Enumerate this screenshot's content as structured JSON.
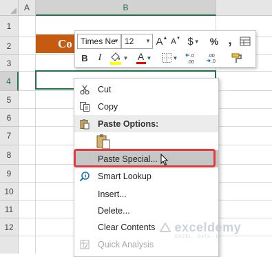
{
  "columns": {
    "corner_arrow": "select-all",
    "a": "A",
    "b": "B"
  },
  "rows": [
    "1",
    "2",
    "3",
    "4",
    "5",
    "6",
    "7",
    "8",
    "9",
    "10",
    "11",
    "12"
  ],
  "title_cell": {
    "text": "Co"
  },
  "mini_toolbar": {
    "font_name": "Times Ne",
    "font_size": "12",
    "increase_font": "A",
    "decrease_font": "A",
    "currency": "$",
    "percent": "%",
    "comma": "‚",
    "bold": "B",
    "italic": "I",
    "font_color_letter": "A",
    "fill_color": "#ffff00",
    "font_color": "#ff0000",
    "decimal_increase": ".00",
    "decimal_decrease": ".00"
  },
  "context_menu": {
    "items": [
      {
        "label": "Cut",
        "icon": "scissors-icon"
      },
      {
        "label": "Copy",
        "icon": "copy-icon"
      },
      {
        "label": "Paste Options:",
        "icon": "paste-icon"
      },
      {
        "label": "Paste Special...",
        "icon": ""
      },
      {
        "label": "Smart Lookup",
        "icon": "smart-lookup-icon"
      },
      {
        "label": "Insert...",
        "icon": ""
      },
      {
        "label": "Delete...",
        "icon": ""
      },
      {
        "label": "Clear Contents",
        "icon": ""
      },
      {
        "label": "Quick Analysis",
        "icon": "quick-analysis-icon"
      }
    ]
  },
  "watermark": {
    "name": "exceldemy",
    "tagline": "EXCEL · DATA · BI"
  },
  "colors": {
    "accent": "#217346",
    "title_fill": "#c55a11",
    "highlight_border": "#e5393c"
  }
}
